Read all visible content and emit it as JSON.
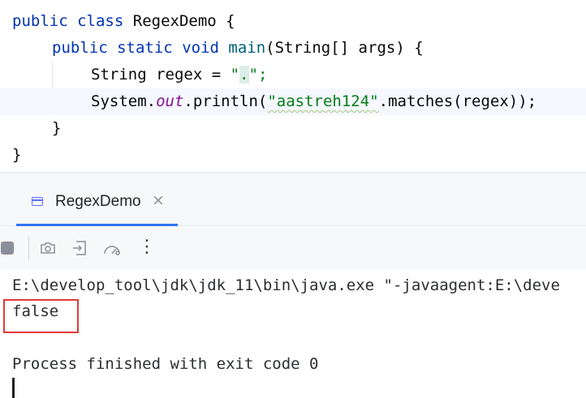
{
  "editor": {
    "lines": [
      {
        "l1_kw1": "public",
        "l1_kw2": "class",
        "l1_name": "RegexDemo",
        "l1_brace": "{"
      },
      {
        "kw1": "public",
        "kw2": "static",
        "kw3": "void",
        "method": "main",
        "params": "(String[] args) {"
      },
      {
        "type": "String regex = ",
        "quote_open": "\"",
        "dot": ".",
        "quote_close": "\";"
      },
      {
        "receiver": "System.",
        "field": "out",
        "call": ".println(",
        "string_literal": "\"aastreh124\"",
        "rest": ".matches(regex));"
      },
      {
        "brace": "}"
      },
      {
        "brace": "}"
      }
    ]
  },
  "run_tab": {
    "label": "RegexDemo",
    "close": "×",
    "icon": "console-window-icon"
  },
  "toolbar": {
    "icons": [
      "stop-icon",
      "camera-icon",
      "exit-icon",
      "gauge-icon",
      "more-vertical-icon"
    ],
    "more_glyph": "⋮"
  },
  "console": {
    "command": "E:\\develop_tool\\jdk\\jdk_11\\bin\\java.exe \"-javaagent:E:\\deve",
    "output": "false",
    "exit_message": "Process finished with exit code 0"
  },
  "colors": {
    "keyword": "#0033b3",
    "method": "#00627a",
    "field": "#871094",
    "string": "#067d17",
    "tab_underline": "#3574f0",
    "highlight_box": "#e03a3a"
  }
}
